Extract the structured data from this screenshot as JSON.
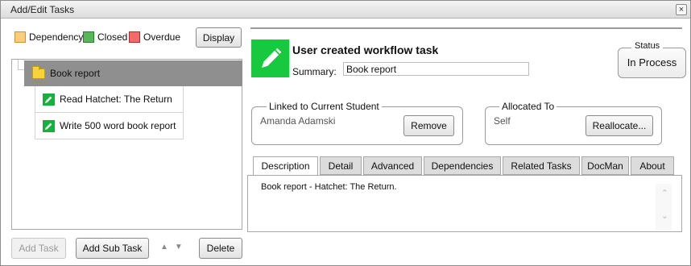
{
  "window": {
    "title": "Add/Edit Tasks",
    "close_glyph": "×"
  },
  "legend": [
    {
      "label": "Dependency",
      "color": "#f7cf7b",
      "border": "#c9962a"
    },
    {
      "label": "Closed",
      "color": "#57b65a",
      "border": "#2b7a2d"
    },
    {
      "label": "Overdue",
      "color": "#f26a6a",
      "border": "#b02828"
    }
  ],
  "toolbar": {
    "display_label": "Display"
  },
  "tree": {
    "root": {
      "label": "Book report",
      "icon": "folder-icon"
    },
    "children": [
      {
        "label": "Read Hatchet: The Return",
        "icon": "pencil-icon"
      },
      {
        "label": "Write 500 word book report",
        "icon": "pencil-icon"
      }
    ]
  },
  "bottom_buttons": {
    "add_task": "Add Task",
    "add_sub_task": "Add Sub Task",
    "move_up": "▲",
    "move_down": "▼",
    "delete": "Delete"
  },
  "task": {
    "type_title": "User created workflow task",
    "summary_label": "Summary:",
    "summary_value": "Book report",
    "icon": "pencil-icon",
    "accent_color": "#16c93f"
  },
  "status": {
    "legend": "Status",
    "value": "In Process"
  },
  "linked": {
    "legend": "Linked to Current Student",
    "value": "Amanda Adamski",
    "button": "Remove"
  },
  "allocated": {
    "legend": "Allocated To",
    "value": "Self",
    "button": "Reallocate..."
  },
  "tabs": [
    {
      "label": "Description",
      "active": true
    },
    {
      "label": "Detail"
    },
    {
      "label": "Advanced"
    },
    {
      "label": "Dependencies"
    },
    {
      "label": "Related Tasks"
    },
    {
      "label": "DocMan"
    },
    {
      "label": "About"
    }
  ],
  "description_text": "Book report - Hatchet: The Return."
}
